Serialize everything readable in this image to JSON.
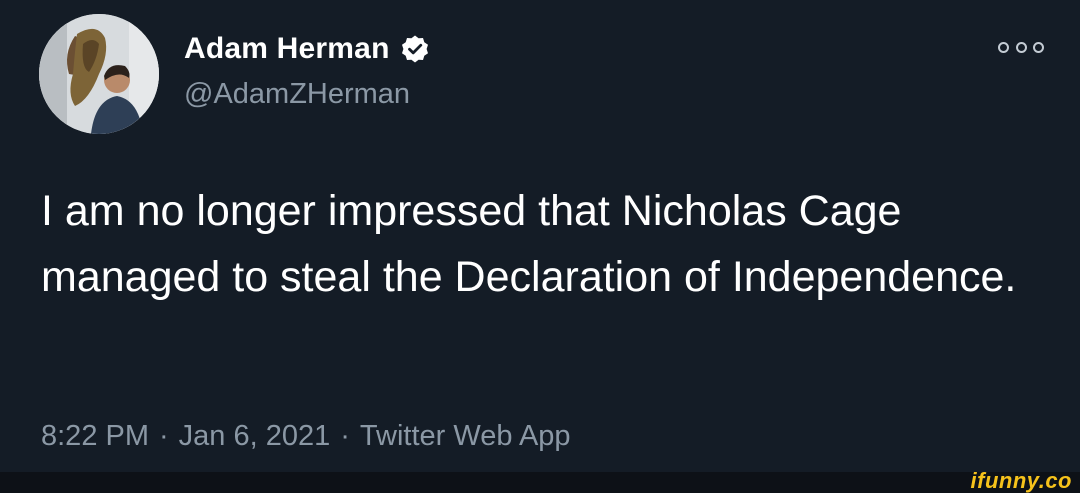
{
  "tweet": {
    "author": {
      "display_name": "Adam Herman",
      "handle": "@AdamZHerman",
      "verified": true
    },
    "text": "I am no longer impressed that Nicholas Cage managed to steal the Declaration of Independence.",
    "time": "8:22 PM",
    "date": "Jan 6, 2021",
    "source": "Twitter Web App",
    "separator": "·"
  },
  "icons": {
    "verified": "verified-check-icon",
    "more": "more-options-icon"
  },
  "watermark": "ifunny.co",
  "colors": {
    "background": "#141c26",
    "text_primary": "#ffffff",
    "text_secondary": "#8b98a5",
    "watermark": "#f6c21b"
  }
}
